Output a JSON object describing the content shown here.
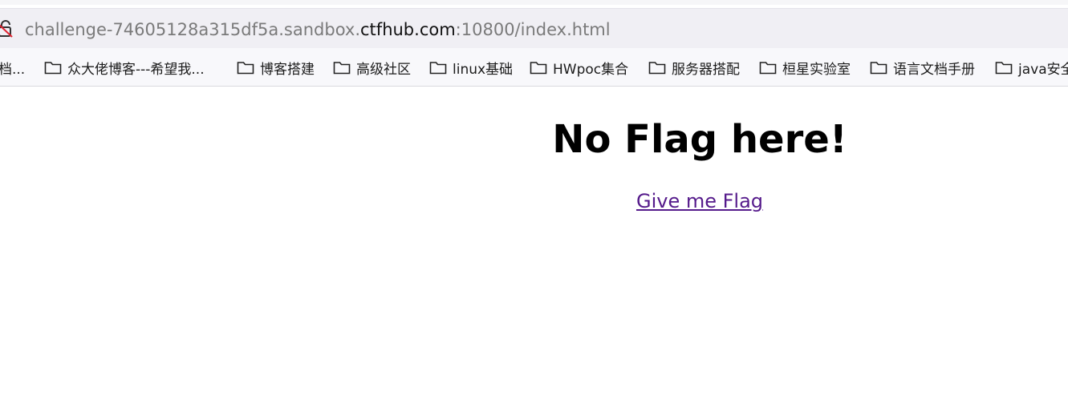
{
  "browser": {
    "url_prefix": "challenge-74605128a315df5a.sandbox.",
    "url_host": "ctfhub.com",
    "url_suffix": ":10800/index.html",
    "lock_icon": "not-secure-lock-icon"
  },
  "bookmarks": [
    {
      "label": "档..."
    },
    {
      "label": "众大佬博客---希望我..."
    },
    {
      "label": "博客搭建"
    },
    {
      "label": "高级社区"
    },
    {
      "label": "linux基础"
    },
    {
      "label": "HWpoc集合"
    },
    {
      "label": "服务器搭配"
    },
    {
      "label": "桓星实验室"
    },
    {
      "label": "语言文档手册"
    },
    {
      "label": "java安全"
    }
  ],
  "page": {
    "heading": "No Flag here!",
    "link_label": "Give me Flag"
  }
}
